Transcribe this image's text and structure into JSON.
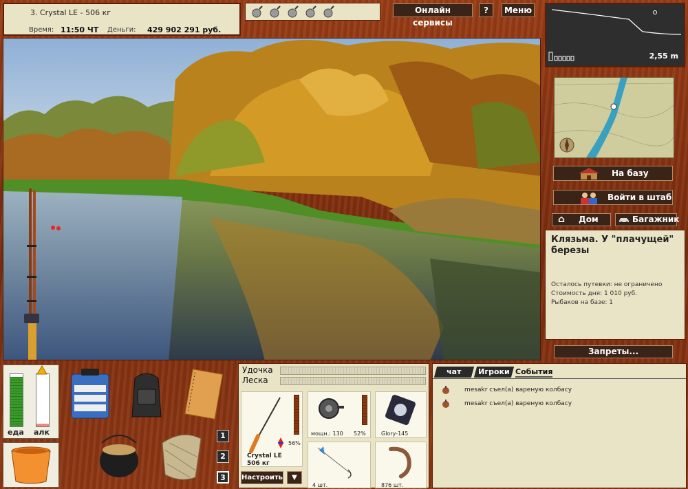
{
  "info": {
    "rod_title": "3. Crystal LE - 506 кг",
    "time_label": "Время:",
    "time_value": "11:50 ЧТ",
    "money_label": "Деньги:",
    "money_value": "429 902 291 руб."
  },
  "header": {
    "online_services": "Онлайн сервисы",
    "help": "?",
    "menu": "Меню"
  },
  "depth": {
    "value": "2,55 m"
  },
  "nav": {
    "to_base": "На базу",
    "headquarters": "Войти в штаб",
    "home": "Дом",
    "trunk": "Багажник",
    "bans": "Запреты..."
  },
  "location": {
    "name": "Клязьма. У \"плачущей\" березы",
    "voucher": "Осталось путевки: не ограничено",
    "day_cost": "Стоимость дня: 1 010 руб.",
    "fishermen": "Рыбаков на базе: 1"
  },
  "meters": {
    "food_label": "еда",
    "alcohol_label": "алк",
    "food_level": 0.95,
    "alcohol_level": 0.05
  },
  "inventory_slots": [
    "1",
    "2",
    "3"
  ],
  "tackle": {
    "rod_label": "Удочка",
    "line_label": "Леска",
    "rod_name": "Crystal LE",
    "rod_weight": "506 кг",
    "rod_percent": "56%",
    "reel_power": "мощн.: 130",
    "reel_percent": "52%",
    "line_name": "Glory-145",
    "hooks_count": "4 шт.",
    "bait_count": "876 шт.",
    "setup_button": "Настроить",
    "dropdown": "▼"
  },
  "chat": {
    "tabs": [
      "чат",
      "Игроки",
      "События"
    ],
    "active_tab": 2,
    "messages": [
      "mesakr съел(а) вареную колбасу",
      "mesakr съел(а) вареную колбасу"
    ]
  }
}
